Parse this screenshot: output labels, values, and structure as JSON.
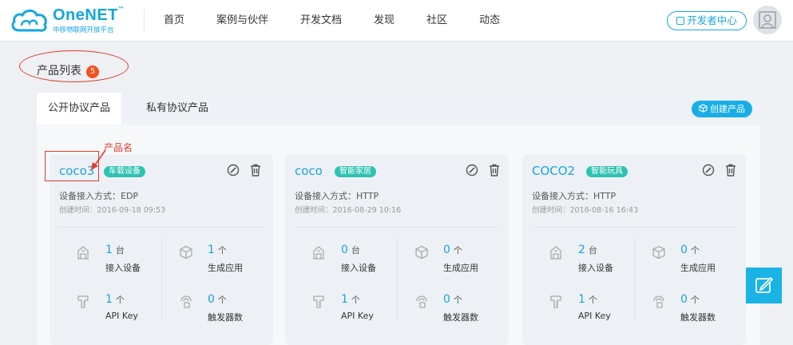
{
  "header": {
    "brand": "OneNET",
    "brand_tm": "™",
    "brand_sub": "中移物联网开放平台",
    "nav": [
      "首页",
      "案例与伙伴",
      "开发文档",
      "发现",
      "社区",
      "动态"
    ],
    "dev_center": "开发者中心"
  },
  "page": {
    "title": "产品列表",
    "count": "5"
  },
  "tabs": {
    "public": "公开协议产品",
    "private": "私有协议产品",
    "create": "创建产品"
  },
  "annotation": {
    "label": "产品名"
  },
  "cards": [
    {
      "name": "coco3",
      "tag": "车载设备",
      "access": "设备接入方式：EDP",
      "created": "创建时间：2016-09-18 09:53",
      "stats": [
        {
          "num": "1",
          "unit": "台",
          "label": "接入设备"
        },
        {
          "num": "1",
          "unit": "个",
          "label": "生成应用"
        },
        {
          "num": "1",
          "unit": "个",
          "label": "API Key"
        },
        {
          "num": "0",
          "unit": "个",
          "label": "触发器数"
        }
      ]
    },
    {
      "name": "coco",
      "tag": "智能家居",
      "access": "设备接入方式：HTTP",
      "created": "创建时间：2016-08-29 10:16",
      "stats": [
        {
          "num": "0",
          "unit": "台",
          "label": "接入设备"
        },
        {
          "num": "0",
          "unit": "个",
          "label": "生成应用"
        },
        {
          "num": "1",
          "unit": "个",
          "label": "API Key"
        },
        {
          "num": "0",
          "unit": "个",
          "label": "触发器数"
        }
      ]
    },
    {
      "name": "COCO2",
      "tag": "智能玩具",
      "access": "设备接入方式：HTTP",
      "created": "创建时间：2016-08-16 16:43",
      "stats": [
        {
          "num": "2",
          "unit": "台",
          "label": "接入设备"
        },
        {
          "num": "0",
          "unit": "个",
          "label": "生成应用"
        },
        {
          "num": "1",
          "unit": "个",
          "label": "API Key"
        },
        {
          "num": "0",
          "unit": "个",
          "label": "触发器数"
        }
      ]
    }
  ],
  "colors": {
    "accent": "#1aa3dd",
    "tag": "#2fc2b2",
    "badge": "#f4511e",
    "annotation": "#e23a2e"
  }
}
